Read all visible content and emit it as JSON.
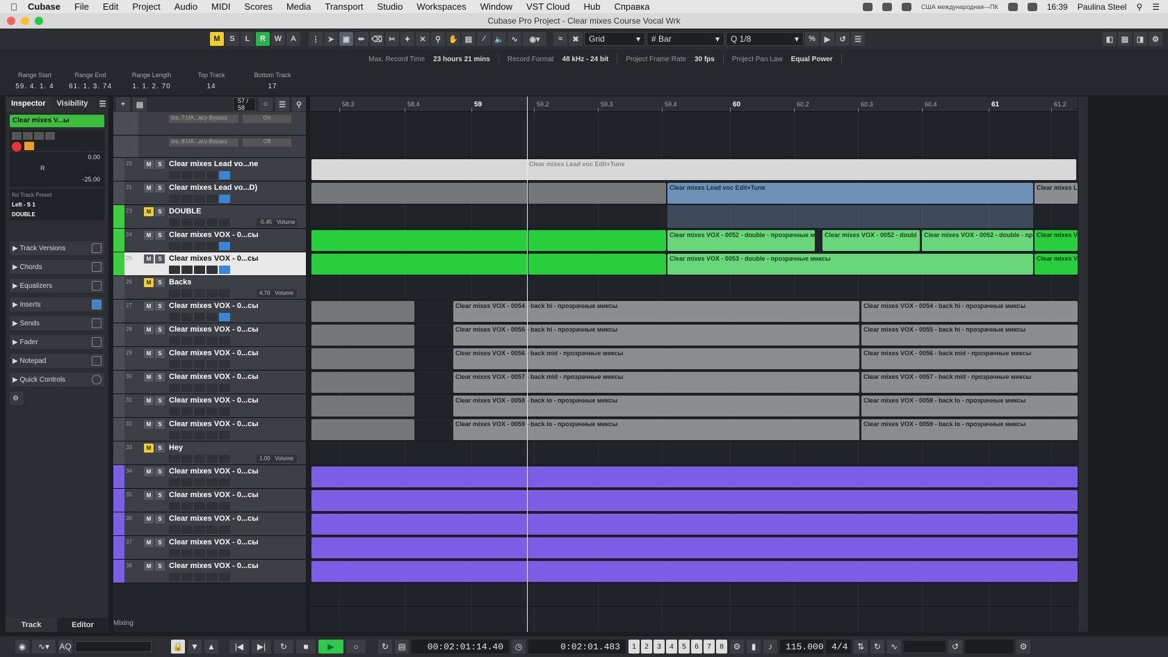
{
  "menubar": {
    "app": "Cubase",
    "items": [
      "File",
      "Edit",
      "Project",
      "Audio",
      "MIDI",
      "Scores",
      "Media",
      "Transport",
      "Studio",
      "Workspaces",
      "Window",
      "VST Cloud",
      "Hub",
      "Справка"
    ],
    "keyboard": "США международная—ПК",
    "clock": "16:39",
    "user": "Paulina Steel"
  },
  "window_title": "Cubase Pro Project - Clear mixes Course Vocal Wrk",
  "toolbar": {
    "buttons": [
      "M",
      "S",
      "L",
      "R",
      "W",
      "A"
    ],
    "snap_type": "Grid",
    "grid_type": "Bar",
    "quantize": "1/8"
  },
  "info_line": {
    "max_record_label": "Max. Record Time",
    "max_record_value": "23 hours 21 mins",
    "record_format_label": "Record Format",
    "record_format_value": "48 kHz - 24 bit",
    "frame_rate_label": "Project Frame Rate",
    "frame_rate_value": "30 fps",
    "pan_law_label": "Project Pan Law",
    "pan_law_value": "Equal Power"
  },
  "range": {
    "start_label": "Range Start",
    "start_value": "59. 4. 1.   4",
    "end_label": "Range End",
    "end_value": "61. 1. 3. 74",
    "length_label": "Range Length",
    "length_value": "1. 1. 2. 70",
    "top_label": "Top Track",
    "top_value": "14",
    "bottom_label": "Bottom Track",
    "bottom_value": "17"
  },
  "inspector": {
    "tab_inspector": "Inspector",
    "tab_visibility": "Visibility",
    "track_name": "Clear mixes V...ы",
    "volume": "0.00",
    "pan": "R",
    "pan_value": "-25.00",
    "preset": "No Track Preset",
    "routing": "Left - S 1",
    "group": "DOUBLE",
    "sections": [
      "Track Versions",
      "Chords",
      "Equalizers",
      "Inserts",
      "Sends",
      "Fader",
      "Notepad",
      "Quick Controls"
    ],
    "bottom_tab_track": "Track",
    "bottom_tab_editor": "Editor"
  },
  "tracklist": {
    "counter": "57 / 58",
    "inserts": [
      {
        "name": "Ins.:7:UA...acy-Bypass",
        "state": "On"
      },
      {
        "name": "Ins.:8:UA...acy-Bypass",
        "state": "Off"
      }
    ],
    "tracks": [
      {
        "num": "20",
        "name": "Clear mixes Lead vo...ne",
        "vol": ""
      },
      {
        "num": "21",
        "name": "Clear mixes Lead vo...D)",
        "vol": ""
      },
      {
        "num": "23",
        "name": "DOUBLE",
        "vol": "-5.45",
        "vol_label": "Volume"
      },
      {
        "num": "24",
        "name": "Clear mixes VOX - 0...сы",
        "vol": ""
      },
      {
        "num": "25",
        "name": "Clear mixes VOX - 0...сы",
        "vol": ""
      },
      {
        "num": "26",
        "name": "Backs",
        "vol": "4.70",
        "vol_label": "Volume"
      },
      {
        "num": "27",
        "name": "Clear mixes VOX - 0...сы",
        "vol": ""
      },
      {
        "num": "28",
        "name": "Clear mixes VOX - 0...сы",
        "vol": ""
      },
      {
        "num": "29",
        "name": "Clear mixes VOX - 0...сы",
        "vol": ""
      },
      {
        "num": "30",
        "name": "Clear mixes VOX - 0...сы",
        "vol": ""
      },
      {
        "num": "31",
        "name": "Clear mixes VOX - 0...сы",
        "vol": ""
      },
      {
        "num": "32",
        "name": "Clear mixes VOX - 0...сы",
        "vol": ""
      },
      {
        "num": "33",
        "name": "Hey",
        "vol": "1.00",
        "vol_label": "Volume"
      },
      {
        "num": "34",
        "name": "Clear mixes VOX - 0...сы",
        "vol": ""
      },
      {
        "num": "35",
        "name": "Clear mixes VOX - 0...сы",
        "vol": ""
      },
      {
        "num": "36",
        "name": "Clear mixes VOX - 0...сы",
        "vol": ""
      },
      {
        "num": "37",
        "name": "Clear mixes VOX - 0...сы",
        "vol": ""
      },
      {
        "num": "38",
        "name": "Clear mixes VOX - 0...сы",
        "vol": ""
      }
    ],
    "footer": "Mixing"
  },
  "ruler": [
    "58.3",
    "58.4",
    "59",
    "59.2",
    "59.3",
    "59.4",
    "60",
    "60.2",
    "60.3",
    "60.4",
    "61",
    "61.2"
  ],
  "events": {
    "lead_edit_tune": "Clear mixes Lead voc Edit+Tune",
    "lead_edit_tune_short": "Clear mixes L",
    "double_52": "Clear mixes VOX - 0052 - double - прозрачные м",
    "double_52b": "Clear mixes VOX - 0052 - doubl",
    "double_52c": "Clear mixes VOX - 0052 - double - пр",
    "double_53": "Clear mixes VOX - 0053 - double - прозрачные миксы",
    "vox_short": "Clear mixes V",
    "backs": [
      "Clear mixes VOX - 0054 - back hi - прозрачные миксы",
      "Clear mixes VOX - 0055 - back hi - прозрачные миксы",
      "Clear mixes VOX - 0056 - back mid - прозрачные миксы",
      "Clear mixes VOX - 0057 - back mid - прозрачные миксы",
      "Clear mixes VOX - 0058 - back lo - прозрачные миксы",
      "Clear mixes VOX - 0059 - back lo - прозрачные миксы"
    ]
  },
  "transport": {
    "position_primary": "00:02:01:14.40",
    "position_secondary": "0:02:01.483",
    "tempo": "115.000",
    "signature": "4/4",
    "markers": [
      "1",
      "2",
      "3",
      "4",
      "5",
      "6",
      "7",
      "8"
    ]
  }
}
